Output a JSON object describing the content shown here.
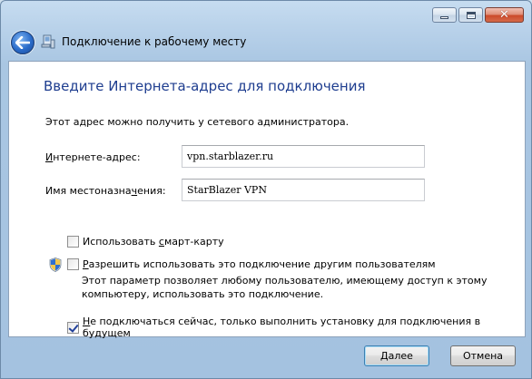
{
  "window": {
    "title": "Подключение к рабочему месту",
    "caption_buttons": {
      "minimize_icon": "minimize-icon",
      "maximize_icon": "maximize-icon",
      "close_icon": "close-icon",
      "close_glyph": "✕"
    }
  },
  "header": {
    "back_icon": "back-arrow-icon",
    "app_icon": "network-connection-icon"
  },
  "main": {
    "heading": "Введите Интернета-адрес для подключения",
    "info": "Этот адрес можно получить у сетевого администратора.",
    "fields": {
      "address": {
        "label_accel": "И",
        "label_rest": "нтернете-адрес:",
        "value": "vpn.starblazer.ru"
      },
      "destination": {
        "label_pre": "Имя местоназна",
        "label_accel": "ч",
        "label_post": "ения:",
        "value": "StarBlazer VPN"
      }
    },
    "options": {
      "smartcard": {
        "label_pre": "Использовать ",
        "label_accel": "с",
        "label_post": "март-карту",
        "checked": false
      },
      "allow_others": {
        "label_accel": "Р",
        "label_post": "азрешить использовать это подключение другим пользователям",
        "checked": false,
        "shield_icon": "uac-shield-icon",
        "description_line1": "Этот параметр позволяет любому пользователю, имеющему доступ к этому",
        "description_line2": "компьютеру, использовать это подключение."
      },
      "dont_connect": {
        "label_accel": "Н",
        "label_post": "е подключаться сейчас, только выполнить установку для подключения в будущем",
        "checked": true
      }
    }
  },
  "footer": {
    "next_accel": "Д",
    "next_post": "алее",
    "cancel_label": "Отмена"
  },
  "colors": {
    "heading": "#1e3d8f",
    "frame": "#a9c6e2",
    "accent": "#3c7fb1"
  }
}
